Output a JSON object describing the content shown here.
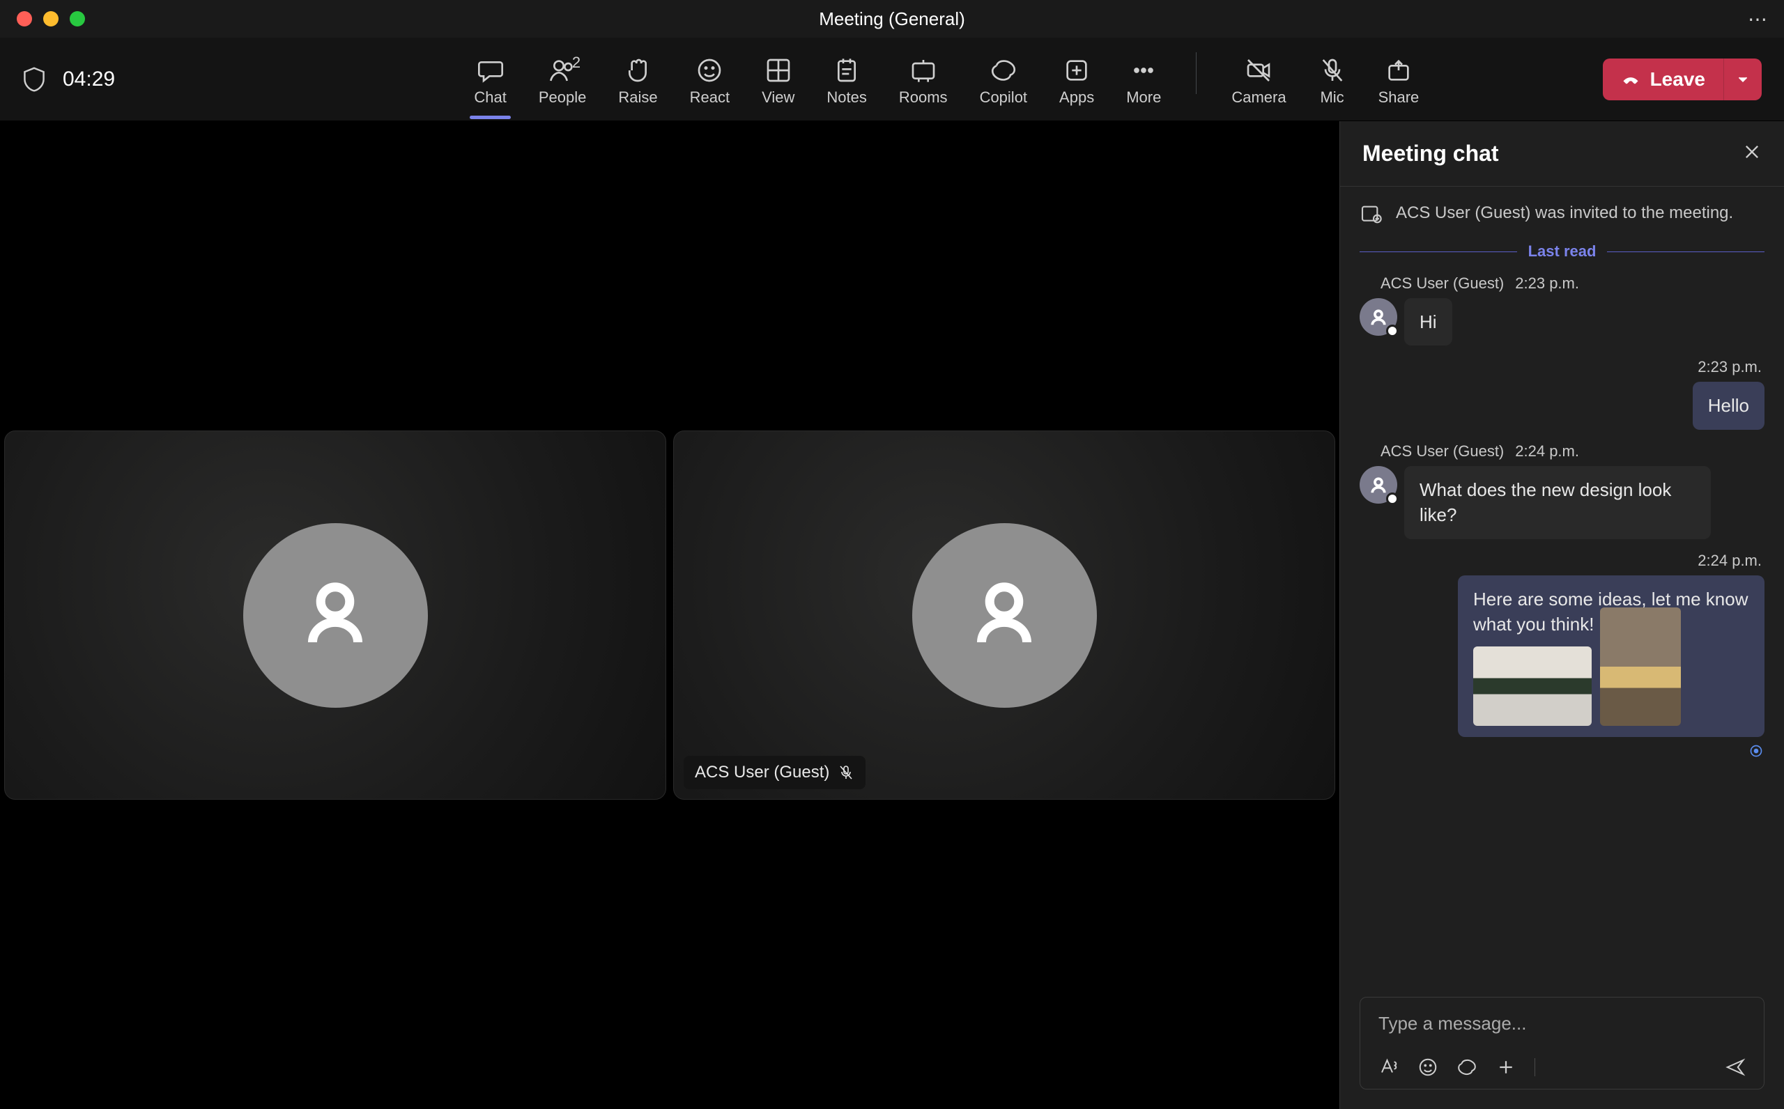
{
  "window": {
    "title": "Meeting (General)",
    "timer": "04:29"
  },
  "toolbar": {
    "items": [
      {
        "label": "Chat"
      },
      {
        "label": "People",
        "badge": "2"
      },
      {
        "label": "Raise"
      },
      {
        "label": "React"
      },
      {
        "label": "View"
      },
      {
        "label": "Notes"
      },
      {
        "label": "Rooms"
      },
      {
        "label": "Copilot"
      },
      {
        "label": "Apps"
      },
      {
        "label": "More"
      }
    ],
    "right": [
      {
        "label": "Camera"
      },
      {
        "label": "Mic"
      },
      {
        "label": "Share"
      }
    ],
    "leave": "Leave"
  },
  "stage": {
    "participant_label": "ACS User (Guest)"
  },
  "chat": {
    "title": "Meeting chat",
    "system_message": "ACS User (Guest) was invited to the meeting.",
    "last_read_label": "Last read",
    "messages": [
      {
        "sender": "ACS User (Guest)",
        "time": "2:23 p.m.",
        "text": "Hi"
      },
      {
        "time": "2:23 p.m.",
        "text": "Hello"
      },
      {
        "sender": "ACS User (Guest)",
        "time": "2:24 p.m.",
        "text": "What does the new design look like?"
      },
      {
        "time": "2:24 p.m.",
        "text": "Here are some ideas, let me know what you think!"
      }
    ],
    "compose_placeholder": "Type a message..."
  }
}
